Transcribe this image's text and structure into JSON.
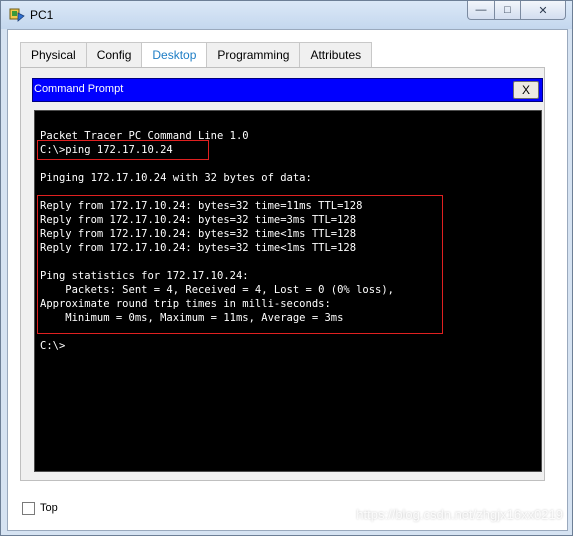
{
  "window": {
    "title": "PC1",
    "icon": "pc-icon",
    "controls": {
      "minimize": "—",
      "maximize": "□",
      "close": "✕"
    }
  },
  "tabs": [
    "Physical",
    "Config",
    "Desktop",
    "Programming",
    "Attributes"
  ],
  "active_tab": "Desktop",
  "command_prompt": {
    "title": "Command Prompt",
    "close_label": "X",
    "lines": [
      "Packet Tracer PC Command Line 1.0",
      "C:\\>ping 172.17.10.24",
      "",
      "Pinging 172.17.10.24 with 32 bytes of data:",
      "",
      "Reply from 172.17.10.24: bytes=32 time=11ms TTL=128",
      "Reply from 172.17.10.24: bytes=32 time=3ms TTL=128",
      "Reply from 172.17.10.24: bytes=32 time<1ms TTL=128",
      "Reply from 172.17.10.24: bytes=32 time<1ms TTL=128",
      "",
      "Ping statistics for 172.17.10.24:",
      "    Packets: Sent = 4, Received = 4, Lost = 0 (0% loss),",
      "Approximate round trip times in milli-seconds:",
      "    Minimum = 0ms, Maximum = 11ms, Average = 3ms",
      "",
      "C:\\>"
    ]
  },
  "top_checkbox": {
    "label": "Top",
    "checked": false
  },
  "watermark": "https://blog.csdn.net/zhgjx16xx0219"
}
